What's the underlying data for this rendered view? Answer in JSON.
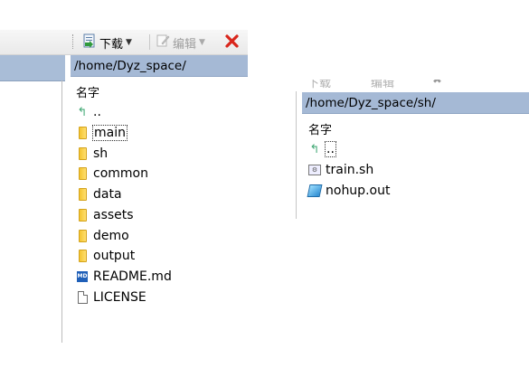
{
  "left_panel": {
    "toolbar": {
      "download_label": "下载",
      "edit_label": "编辑",
      "download_icon": "download-icon",
      "edit_icon": "edit-icon",
      "delete_icon": "delete-x-icon"
    },
    "path": "/home/Dyz_space/",
    "column_header": "名字",
    "items": [
      {
        "name": "..",
        "type": "parent-dir"
      },
      {
        "name": "main",
        "type": "folder",
        "focused": true
      },
      {
        "name": "sh",
        "type": "folder"
      },
      {
        "name": "common",
        "type": "folder"
      },
      {
        "name": "data",
        "type": "folder"
      },
      {
        "name": "assets",
        "type": "folder"
      },
      {
        "name": "demo",
        "type": "folder"
      },
      {
        "name": "output",
        "type": "folder"
      },
      {
        "name": "README.md",
        "type": "markdown-file"
      },
      {
        "name": "LICENSE",
        "type": "file"
      }
    ]
  },
  "right_panel": {
    "toolbar": {
      "download_label": "下载",
      "edit_label": "编辑"
    },
    "path": "/home/Dyz_space/sh/",
    "column_header": "名字",
    "items": [
      {
        "name": "..",
        "type": "parent-dir",
        "focused": true
      },
      {
        "name": "train.sh",
        "type": "shell-file"
      },
      {
        "name": "nohup.out",
        "type": "out-file"
      }
    ]
  },
  "colors": {
    "path_bar": "#a5b9d5",
    "delete_red": "#d9261c",
    "folder_yellow": "#f4c430"
  }
}
